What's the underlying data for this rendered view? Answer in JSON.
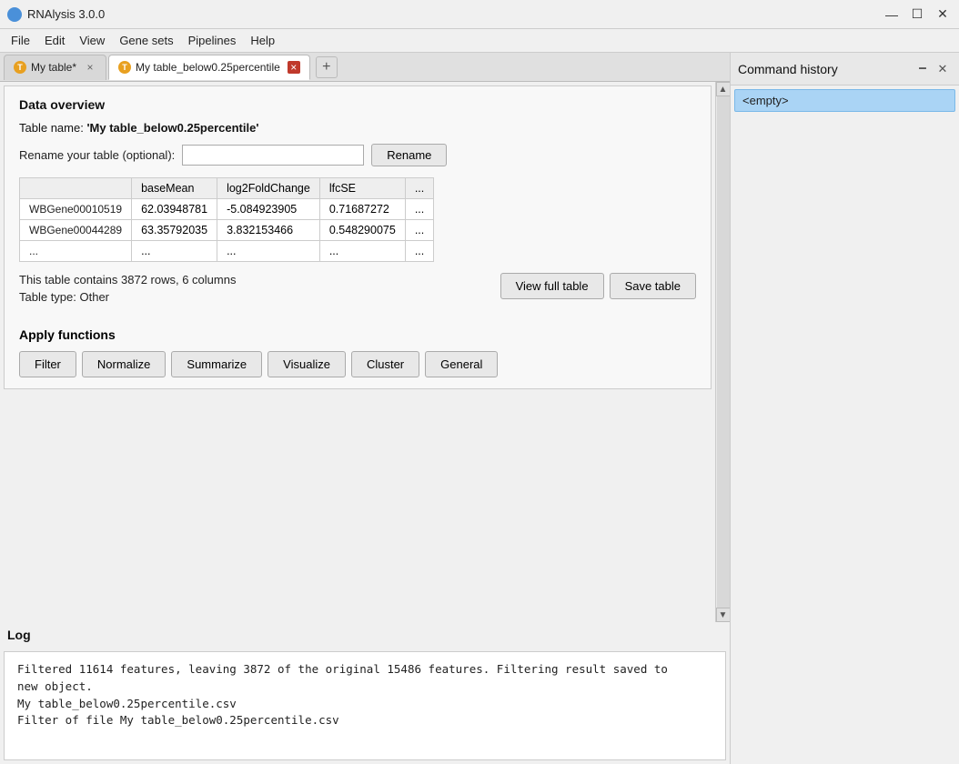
{
  "app": {
    "title": "RNAlysis 3.0.0",
    "icon": "T"
  },
  "window_controls": {
    "minimize": "—",
    "maximize": "☐",
    "close": "✕"
  },
  "menu": {
    "items": [
      "File",
      "Edit",
      "View",
      "Gene sets",
      "Pipelines",
      "Help"
    ]
  },
  "tabs": [
    {
      "id": "tab1",
      "label": "My table*",
      "icon": "T",
      "active": false,
      "closable": true
    },
    {
      "id": "tab2",
      "label": "My table_below0.25percentile",
      "icon": "T",
      "active": true,
      "closable": true
    }
  ],
  "add_tab_label": "+",
  "data_overview": {
    "section_title": "Data overview",
    "table_name_label": "Table name:",
    "table_name_value": "'My table_below0.25percentile'",
    "rename_label": "Rename your table (optional):",
    "rename_placeholder": "",
    "rename_btn": "Rename",
    "table": {
      "headers": [
        "",
        "baseMean",
        "log2FoldChange",
        "lfcSE",
        "..."
      ],
      "rows": [
        [
          "WBGene00010519",
          "62.03948781",
          "-5.084923905",
          "0.71687272",
          "..."
        ],
        [
          "WBGene00044289",
          "63.35792035",
          "3.832153466",
          "0.548290075",
          "..."
        ],
        [
          "...",
          "...",
          "...",
          "...",
          "..."
        ]
      ]
    },
    "row_count_label": "This table contains 3872 rows, 6 columns",
    "table_type_label": "Table type: Other",
    "view_full_btn": "View full table",
    "save_table_btn": "Save table",
    "apply_functions": {
      "title": "Apply functions",
      "buttons": [
        "Filter",
        "Normalize",
        "Summarize",
        "Visualize",
        "Cluster",
        "General"
      ]
    }
  },
  "log": {
    "title": "Log",
    "lines": [
      "Filtered 11614 features, leaving 3872 of the original 15486 features. Filtering result saved to",
      "new object.",
      "My table_below0.25percentile.csv",
      "Filter of file My table_below0.25percentile.csv"
    ]
  },
  "command_history": {
    "title": "Command history",
    "minimize_btn": "🗕",
    "close_btn": "✕",
    "items": [
      "<empty>"
    ]
  }
}
